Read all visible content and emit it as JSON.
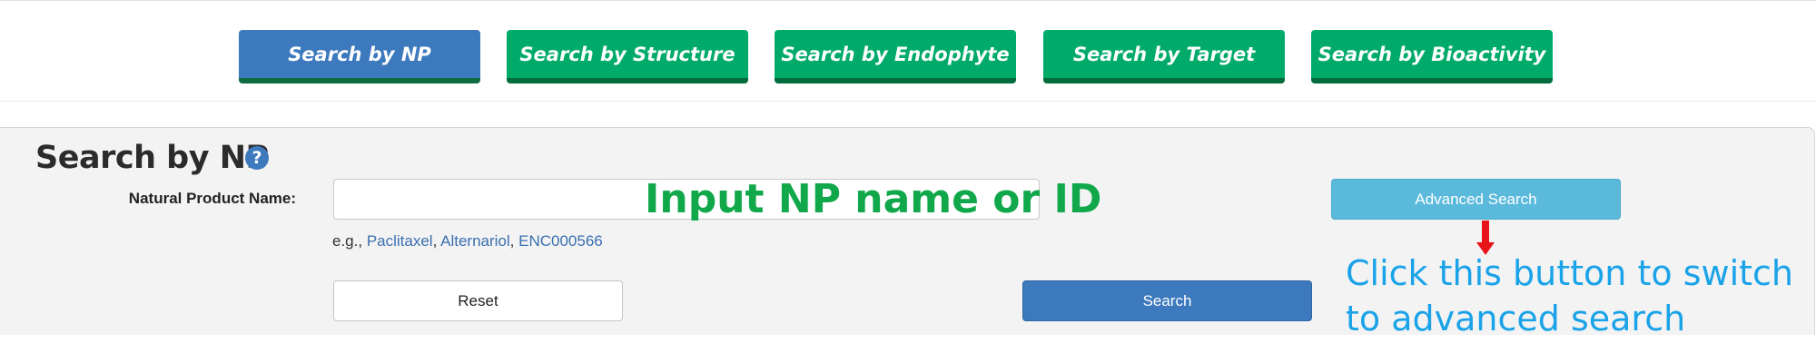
{
  "tabs": [
    {
      "label": "Search by NP",
      "active": true
    },
    {
      "label": "Search by Structure",
      "active": false
    },
    {
      "label": "Search by Endophyte",
      "active": false
    },
    {
      "label": "Search by Target",
      "active": false
    },
    {
      "label": "Search by Bioactivity",
      "active": false
    }
  ],
  "panel": {
    "title": "Search by NP",
    "help_icon_glyph": "?",
    "field_label": "Natural Product Name:",
    "input_value": "",
    "input_placeholder": "",
    "input_annotation": "Input NP name or ID",
    "advanced_search_label": "Advanced Search",
    "example_prefix": "e.g.,",
    "examples": [
      "Paclitaxel",
      "Alternariol",
      "ENC000566"
    ],
    "reset_label": "Reset",
    "search_label": "Search",
    "switch_annotation_line1": "Click this button to switch",
    "switch_annotation_line2": "to advanced search"
  },
  "colors": {
    "tab_active": "#3c79bd",
    "tab_inactive": "#00ab6a",
    "advanced_button": "#5bbadc",
    "search_button": "#3c79bd",
    "input_annotation": "#10a84a",
    "switch_annotation": "#1aa3e8",
    "arrow": "#e8141a"
  }
}
